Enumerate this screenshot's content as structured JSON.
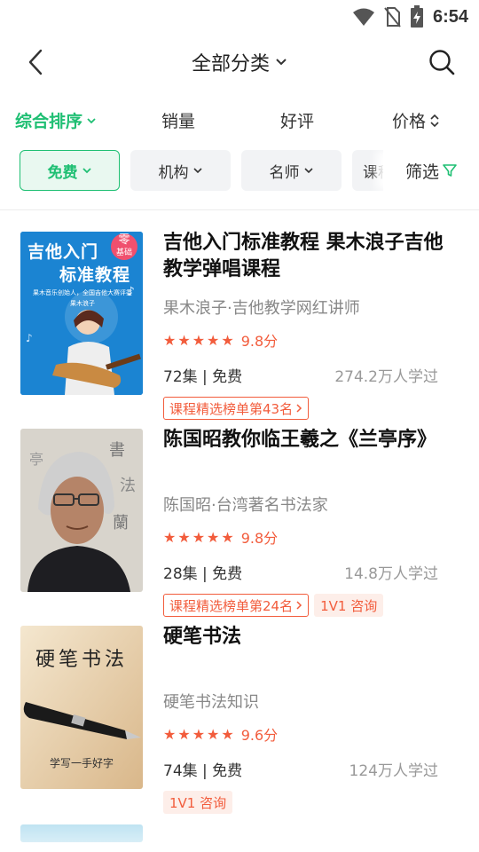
{
  "status": {
    "time": "6:54"
  },
  "nav": {
    "title": "全部分类"
  },
  "sort": {
    "items": [
      "综合排序",
      "销量",
      "好评",
      "价格"
    ]
  },
  "filters": {
    "chips": [
      "免费",
      "机构",
      "名师",
      "课程"
    ],
    "screen_label": "筛选"
  },
  "courses": [
    {
      "title": "吉他入门标准教程  果木浪子吉他教学弹唱课程",
      "author": "果木浪子·吉他教学网红讲师",
      "rating": "9.8分",
      "stars": 5,
      "meta": "72集 | 免费",
      "learners": "274.2万人学过",
      "rank_tag": "课程精选榜单第43名",
      "consult_tag": "",
      "cover": {
        "title_line1": "吉他入门",
        "title_line2": "标准教程",
        "badge_top": "零",
        "badge_bottom": "基础",
        "caption1": "果木音乐创始人，全国吉他大赛评委",
        "caption2": "果木浪子"
      }
    },
    {
      "title": "陈国昭教你临王羲之《兰亭序》",
      "author": "陈国昭·台湾著名书法家",
      "rating": "9.8分",
      "stars": 5,
      "meta": "28集 | 免费",
      "learners": "14.8万人学过",
      "rank_tag": "课程精选榜单第24名",
      "consult_tag": "1V1 咨询",
      "cover": {}
    },
    {
      "title": "硬笔书法",
      "author": "硬笔书法知识",
      "rating": "9.6分",
      "stars": 5,
      "meta": "74集 | 免费",
      "learners": "124万人学过",
      "rank_tag": "",
      "consult_tag": "1V1 咨询",
      "cover": {
        "title": "硬笔书法",
        "caption": "学写一手好字"
      }
    }
  ],
  "colors": {
    "accent": "#1fbf73",
    "rating": "#f25c3c"
  }
}
